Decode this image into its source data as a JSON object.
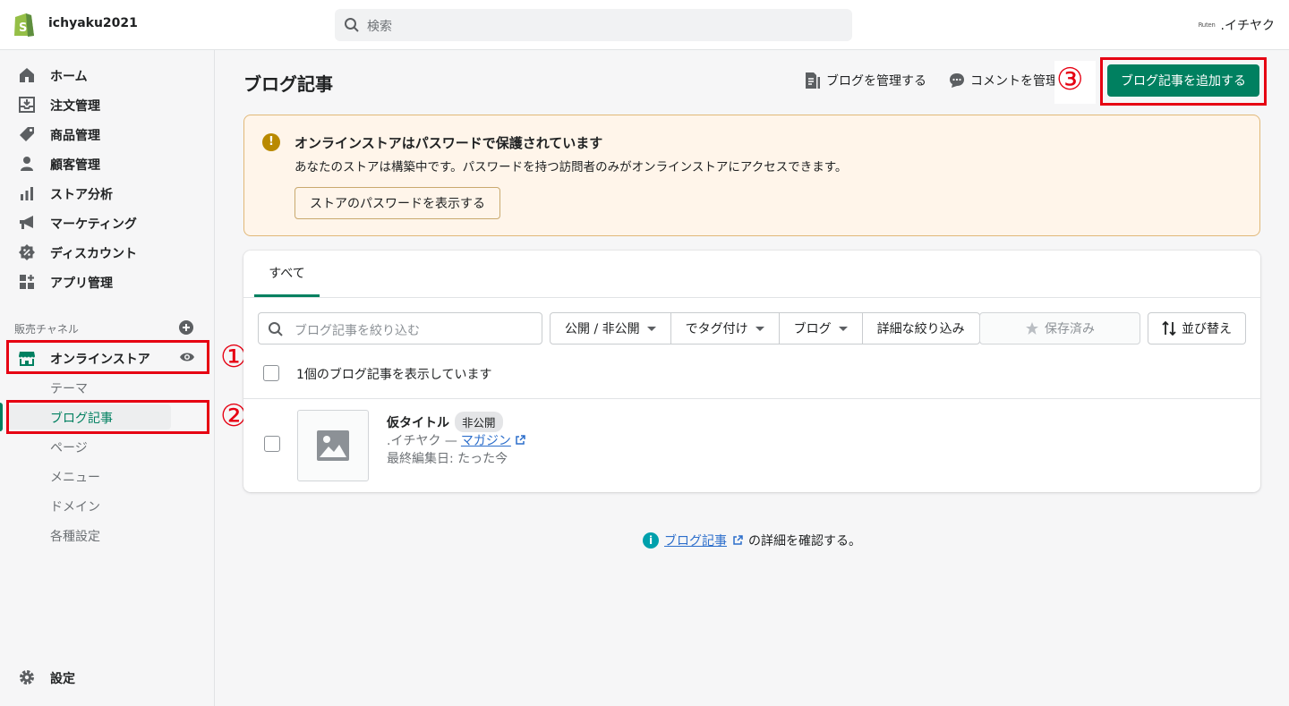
{
  "topbar": {
    "store_name": "ichyaku2021",
    "search_placeholder": "検索",
    "account_logo_text": "Ruten",
    "account_name": ".イチヤク"
  },
  "sidebar": {
    "items": [
      {
        "label": "ホーム",
        "icon": "home-icon"
      },
      {
        "label": "注文管理",
        "icon": "orders-icon"
      },
      {
        "label": "商品管理",
        "icon": "tag-icon"
      },
      {
        "label": "顧客管理",
        "icon": "customer-icon"
      },
      {
        "label": "ストア分析",
        "icon": "analytics-icon"
      },
      {
        "label": "マーケティング",
        "icon": "megaphone-icon"
      },
      {
        "label": "ディスカウント",
        "icon": "discount-icon"
      },
      {
        "label": "アプリ管理",
        "icon": "apps-icon"
      }
    ],
    "channels_label": "販売チャネル",
    "online_store": "オンラインストア",
    "sub_items": [
      "テーマ",
      "ブログ記事",
      "ページ",
      "メニュー",
      "ドメイン",
      "各種設定"
    ],
    "settings": "設定"
  },
  "annotations": {
    "n1": "①",
    "n2": "②",
    "n3": "③",
    "color": "#e60012"
  },
  "header": {
    "title": "ブログ記事",
    "manage_blogs": "ブログを管理する",
    "manage_comments": "コメントを管理",
    "add_post": "ブログ記事を追加する"
  },
  "banner": {
    "title": "オンラインストアはパスワードで保護されています",
    "description": "あなたのストアは構築中です。パスワードを持つ訪問者のみがオンラインストアにアクセスできます。",
    "button": "ストアのパスワードを表示する"
  },
  "list": {
    "tab_all": "すべて",
    "filter_placeholder": "ブログ記事を絞り込む",
    "filters": [
      "公開 / 非公開",
      "でタグ付け",
      "ブログ",
      "詳細な絞り込み"
    ],
    "saved": "保存済み",
    "sort": "並び替え",
    "count_text": "1個のブログ記事を表示しています",
    "posts": [
      {
        "title": "仮タイトル",
        "status": "非公開",
        "store": ".イチヤク —",
        "blog": "マガジン",
        "edited": "最終編集日: たった今"
      }
    ]
  },
  "footer": {
    "link": "ブログ記事",
    "suffix": "の詳細を確認する。"
  },
  "colors": {
    "primary": "#008060",
    "warning_bg": "#fff5ea",
    "link": "#2c6ecb"
  }
}
